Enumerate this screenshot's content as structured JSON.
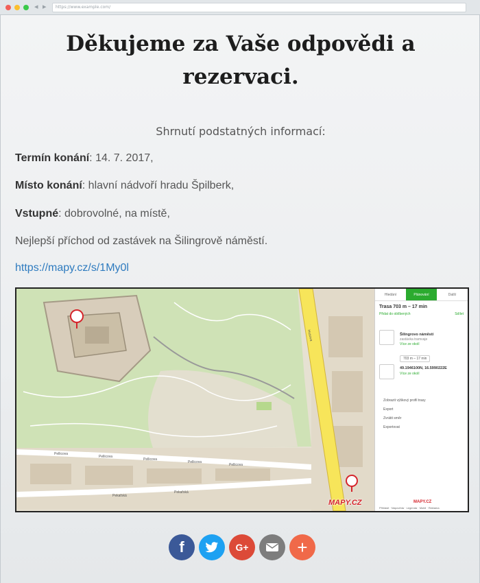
{
  "browser": {
    "url": "https://www.example.com/"
  },
  "page": {
    "title": "Děkujeme za Vaše odpovědi a rezervaci.",
    "summary_heading": "Shrnutí podstatných informací:",
    "details": [
      {
        "label": "Termín konání",
        "value": ": 14. 7. 2017,"
      },
      {
        "label": "Místo konání",
        "value": ": hlavní nádvoří hradu Špilberk,"
      },
      {
        "label": "Vstupné",
        "value": ": dobrovolné, na místě,"
      }
    ],
    "transport_note": "Nejlepší příchod od zastávek na Šilingrově náměstí.",
    "map_link": "https://mapy.cz/s/1My0l"
  },
  "map": {
    "logo": "MAPY.CZ",
    "panel": {
      "tabs": [
        "Hledání",
        "Plánování",
        "Další"
      ],
      "route_title": "Trasa 703 m – 17 min",
      "action_save": "Přidat do oblíbených",
      "action_share": "Sdílet",
      "start_place": "Šilingrovo náměstí",
      "start_sub": "zastávka tramvaje",
      "start_link": "Více ze okolí",
      "duration": "703 m – 17 min",
      "end_coords": "49.1946100N, 16.5990222E",
      "end_link": "Více ze okolí",
      "menu": [
        "Zobrazit výškový profil trasy",
        "Export",
        "Zvrátit směr",
        "Exportovat"
      ],
      "logo": "MAPY.CZ",
      "footer": "Přihlásit · Nápověda · Legenda · Mobil · Reklama"
    },
    "street_labels": [
      "Pellicova",
      "Pellicova",
      "Pellicova",
      "Pellicova",
      "Pellicova",
      "Pekařská",
      "Pekařská",
      "Husova"
    ]
  },
  "social": {
    "icons": [
      "facebook-icon",
      "twitter-icon",
      "google-plus-icon",
      "email-icon",
      "plus-icon"
    ],
    "facebook": "f",
    "google": "G+",
    "plus": "+",
    "colors": {
      "facebook": "#3b5998",
      "twitter": "#1da1f2",
      "google": "#dc4a38",
      "email": "#7d7d7d",
      "plus": "#f06949"
    }
  }
}
